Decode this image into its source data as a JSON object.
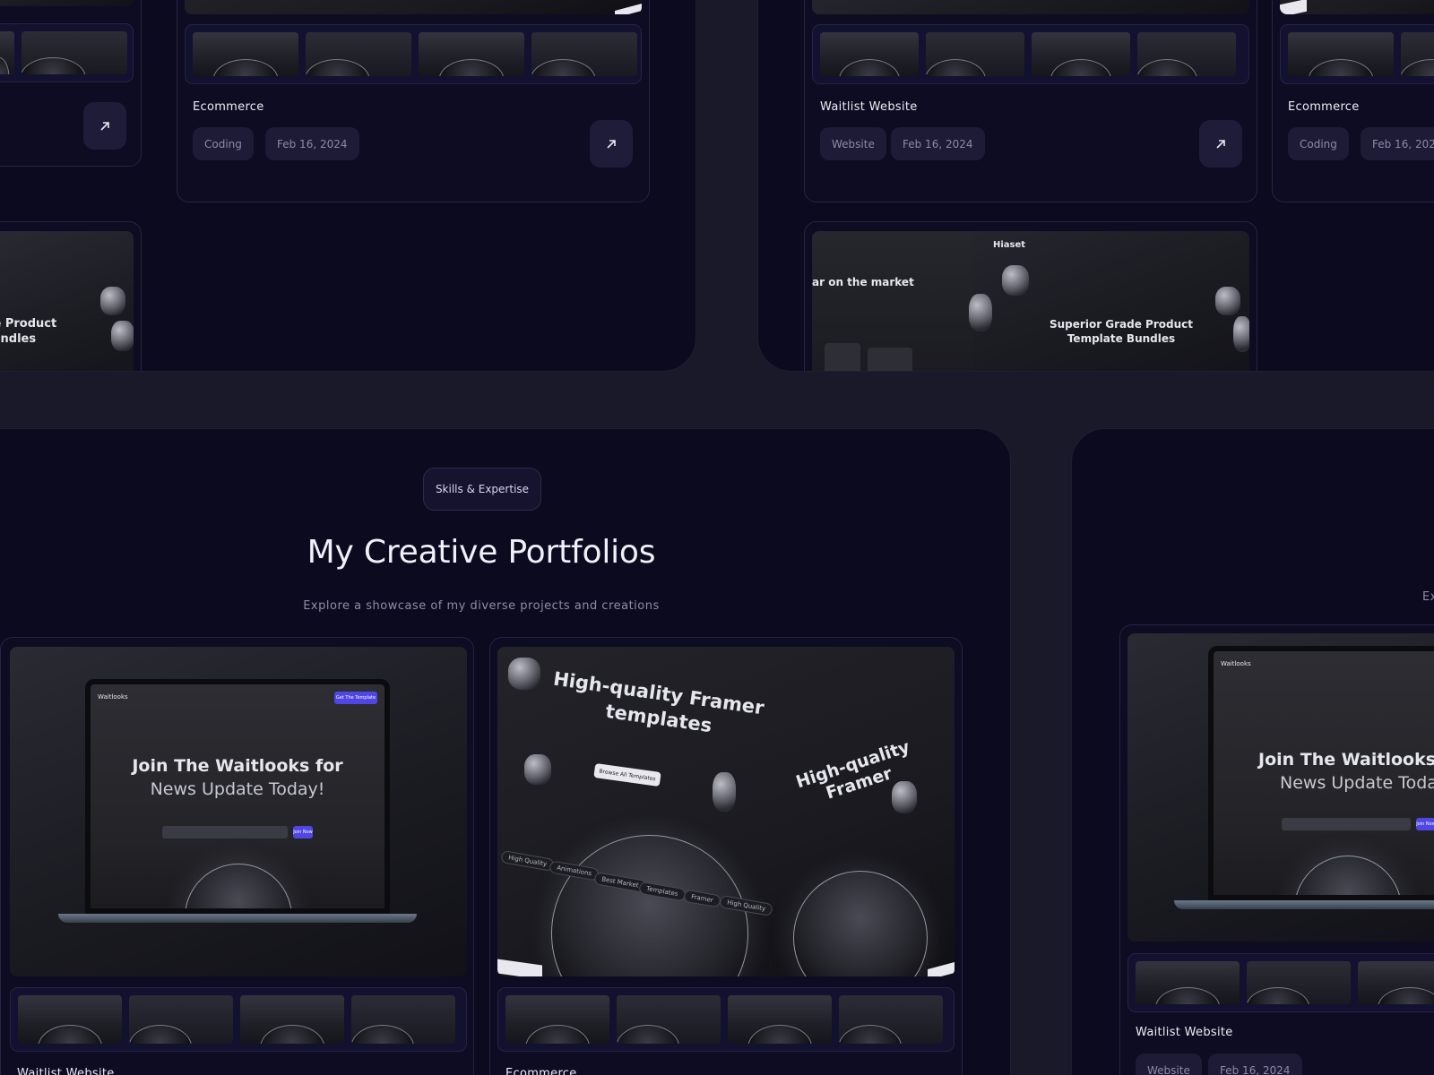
{
  "section": {
    "badge": "Skills & Expertise",
    "title": "My Creative Portfolios",
    "subtitle": "Explore a showcase of my diverse projects and creations",
    "subtitle_clipped": "Ex"
  },
  "top_cards": [
    {
      "title": "Ecommerce",
      "tags": [
        "Coding",
        "Feb 16, 2024"
      ]
    },
    {
      "title": "Waitlist Website",
      "tags": [
        "Website",
        "Feb 16, 2024"
      ]
    },
    {
      "title": "Ecommerce",
      "tags": [
        "Coding",
        "Feb 16, 2024"
      ]
    }
  ],
  "bottom_cards": [
    {
      "title": "Waitlist Website"
    },
    {
      "title": "Ecommerce"
    },
    {
      "title": "Waitlist Website",
      "tags": [
        "Website",
        "Feb 16, 2024"
      ]
    }
  ],
  "mock": {
    "waitlist_line1": "Join The Waitlooks for",
    "waitlist_line2": "News Update Today!",
    "waitlist_brand": "Waitlooks",
    "waitlist_cta": "Get The Template",
    "waitlist_join": "Join Now",
    "framer_line1": "High-quality Framer",
    "framer_line2": "templates",
    "framer_browse": "Browse All Templates",
    "framer_pills": [
      "High Quality",
      "Animations",
      "Best Market",
      "Templates",
      "Framer",
      "High Quality"
    ],
    "product_brand": "Hiaset",
    "product_line1": "Superior Grade Product",
    "product_line2": "Template Bundles",
    "product_left": "ar on the market",
    "product_left_clip1": "rade Product",
    "product_left_clip2": "e Bundles"
  },
  "colors": {
    "background": "#191929",
    "panel": "#0c0a1e",
    "accent": "#4f46e5"
  }
}
